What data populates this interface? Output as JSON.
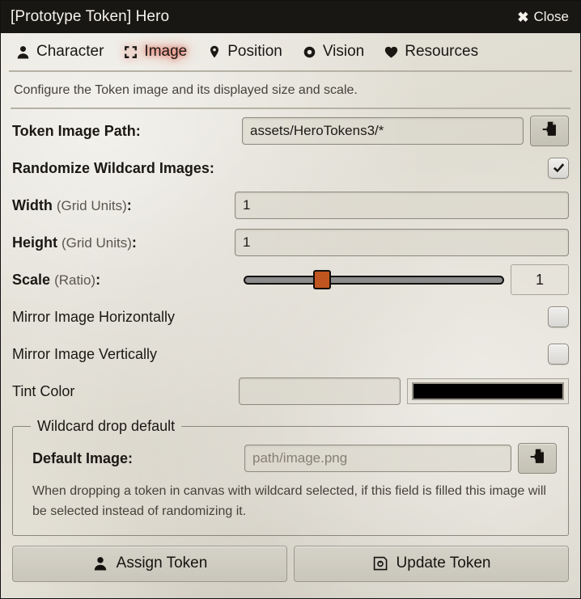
{
  "window": {
    "title": "[Prototype Token] Hero",
    "close_label": "Close",
    "close_icon": "close-x-icon"
  },
  "tabs": [
    {
      "label": "Character",
      "icon": "user-icon",
      "active": false
    },
    {
      "label": "Image",
      "icon": "image-frame-icon",
      "active": true
    },
    {
      "label": "Position",
      "icon": "map-pin-icon",
      "active": false
    },
    {
      "label": "Vision",
      "icon": "eye-icon",
      "active": false
    },
    {
      "label": "Resources",
      "icon": "heart-icon",
      "active": false
    }
  ],
  "hint": "Configure the Token image and its displayed size and scale.",
  "fields": {
    "token_image_path": {
      "label": "Token Image Path:",
      "value": "assets/HeroTokens3/*",
      "picker_icon": "file-import-icon"
    },
    "randomize_wildcard": {
      "label": "Randomize Wildcard Images:",
      "checked": true
    },
    "width": {
      "label": "Width",
      "sub": "(Grid Units)",
      "suffix": ":",
      "value": "1"
    },
    "height": {
      "label": "Height",
      "sub": "(Grid Units)",
      "suffix": ":",
      "value": "1"
    },
    "scale": {
      "label": "Scale",
      "sub": "(Ratio)",
      "suffix": ":",
      "value": "1",
      "slider_percent": 30,
      "thumb_color": "#c1551f"
    },
    "mirror_horizontal": {
      "label": "Mirror Image Horizontally",
      "checked": false
    },
    "mirror_vertical": {
      "label": "Mirror Image Vertically",
      "checked": false
    },
    "tint_color": {
      "label": "Tint Color",
      "value": "",
      "swatch_color": "#000000"
    }
  },
  "wildcard_fieldset": {
    "legend": "Wildcard drop default",
    "default_image": {
      "label": "Default Image:",
      "placeholder": "path/image.png",
      "value": "",
      "picker_icon": "file-import-icon"
    },
    "note": "When dropping a token in canvas with wildcard selected, if this field is filled this image will be selected instead of randomizing it."
  },
  "footer": {
    "assign_token": {
      "label": "Assign Token",
      "icon": "user-icon"
    },
    "update_token": {
      "label": "Update Token",
      "icon": "save-floppy-icon"
    }
  },
  "colors": {
    "accent_active_tab": "#e4503c",
    "slider_thumb": "#c1551f",
    "titlebar_bg": "#191714",
    "paper_bg": "#e2dfd5"
  }
}
